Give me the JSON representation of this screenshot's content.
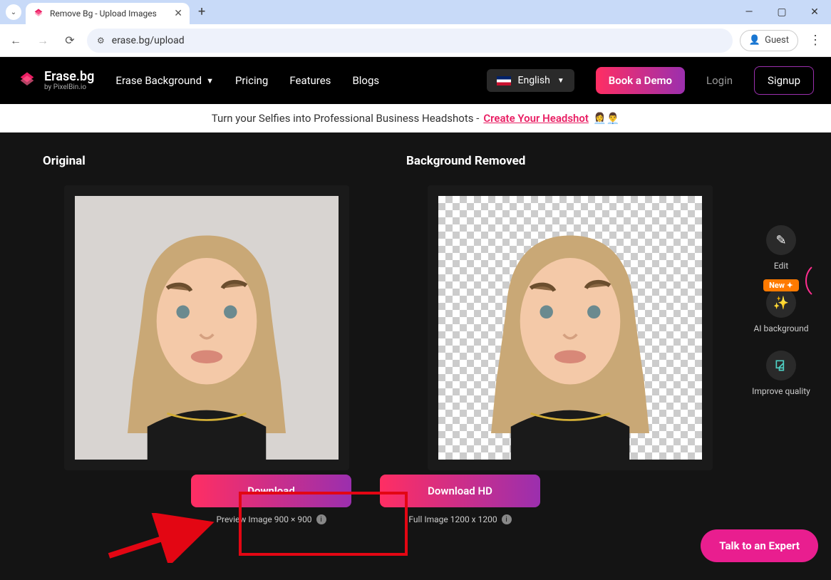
{
  "browser": {
    "tab_title": "Remove Bg - Upload Images",
    "url": "erase.bg/upload",
    "guest_label": "Guest"
  },
  "header": {
    "logo_title": "Erase.bg",
    "logo_sub": "by PixelBin.io",
    "nav": {
      "erase_bg": "Erase Background",
      "pricing": "Pricing",
      "features": "Features",
      "blogs": "Blogs"
    },
    "language": "English",
    "book_demo": "Book a Demo",
    "login": "Login",
    "signup": "Signup"
  },
  "banner": {
    "text": "Turn your Selfies into Professional Business Headshots - ",
    "link": "Create Your Headshot",
    "emoji": "👩‍💼👨‍💼"
  },
  "main": {
    "original_label": "Original",
    "removed_label": "Background Removed",
    "download": {
      "label": "Download",
      "info": "Preview Image 900 × 900"
    },
    "download_hd": {
      "label": "Download HD",
      "info": "Full Image 1200 x 1200"
    }
  },
  "tools": {
    "edit": "Edit",
    "ai_bg": "AI background",
    "new_badge": "New ✦",
    "improve": "Improve quality"
  },
  "expert_btn": "Talk to an Expert"
}
